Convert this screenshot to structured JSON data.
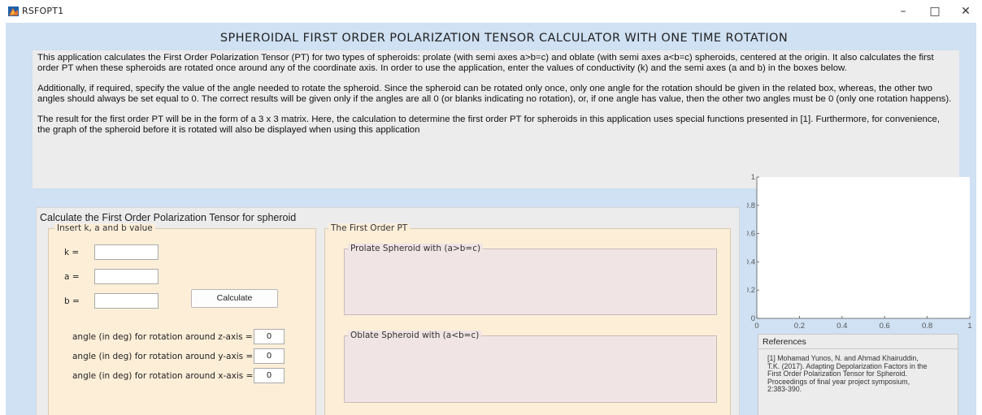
{
  "window": {
    "title": "RSFOPT1",
    "controls": {
      "minimize": "–",
      "maximize": "□",
      "close": "✕"
    },
    "icon": "matlab-app-icon"
  },
  "page": {
    "title": "SPHEROIDAL FIRST ORDER POLARIZATION TENSOR CALCULATOR WITH ONE TIME ROTATION"
  },
  "description": {
    "paragraphs": [
      "This application calculates the First Order Polarization Tensor (PT) for two types of spheroids: prolate (with semi axes a>b=c) and oblate (with semi axes a<b=c) spheroids, centered at the origin. It also calculates the first order PT when these spheroids are rotated once around any of the coordinate axis. In order to use the application, enter the values of conductivity (k) and the semi axes (a and b) in the boxes below.",
      "Additionally, if required, specify the value of the angle needed to rotate the spheroid. Since the spheroid can be rotated only once, only one angle for the rotation should be given in the related box, whereas, the other two angles should always be set equal to 0. The correct results will be given only if the angles are all 0 (or blanks indicating no rotation), or, if one angle has value, then the other two angles must be 0 (only one rotation happens).",
      "The result for the first order PT will be in the form of a 3 x 3 matrix. Here, the calculation to determine the first order PT for spheroids in this application uses special functions presented in [1]. Furthermore, for convenience, the graph of the spheroid before it is rotated will also be displayed when using this application"
    ]
  },
  "calc_panel": {
    "title": "Calculate the First Order Polarization Tensor for spheroid",
    "insert": {
      "legend": "Insert k, a and b value",
      "k_label": "k =",
      "a_label": "a =",
      "b_label": "b =",
      "k_value": "",
      "a_value": "",
      "b_value": "",
      "calculate_label": "Calculate",
      "angle_z_label": "angle (in deg) for rotation around z-axis =",
      "angle_y_label": "angle (in deg) for rotation around y-axis =",
      "angle_x_label": "angle (in deg) for rotation around x-axis =",
      "angle_z_value": "0",
      "angle_y_value": "0",
      "angle_x_value": "0"
    },
    "pt": {
      "legend": "The First Order PT",
      "prolate_legend": "Prolate Spheroid with (a>b=c)",
      "oblate_legend": "Oblate Spheroid with (a<b=c)"
    }
  },
  "chart_data": {
    "type": "scatter",
    "x": [],
    "y": [],
    "xlim": [
      0,
      1
    ],
    "ylim": [
      0,
      1
    ],
    "xticks": [
      "0",
      "0.2",
      "0.4",
      "0.6",
      "0.8",
      "1"
    ],
    "yticks": [
      "0",
      "0.2",
      "0.4",
      "0.6",
      "0.8",
      "1"
    ],
    "grid": false
  },
  "references": {
    "title": "References",
    "body": "[1] Mohamad Yunos, N. and Ahmad Khairuddin, T.K. (2017). Adapting Depolarization Factors in the First Order Polarization Tensor for Spheroid. Proceedings of final year project symposium, 2:383-390."
  },
  "colors": {
    "background": "#cfe1f3",
    "panel": "#ececec",
    "input_panel": "#fdeed8",
    "result_panel": "#f0e4e4"
  }
}
